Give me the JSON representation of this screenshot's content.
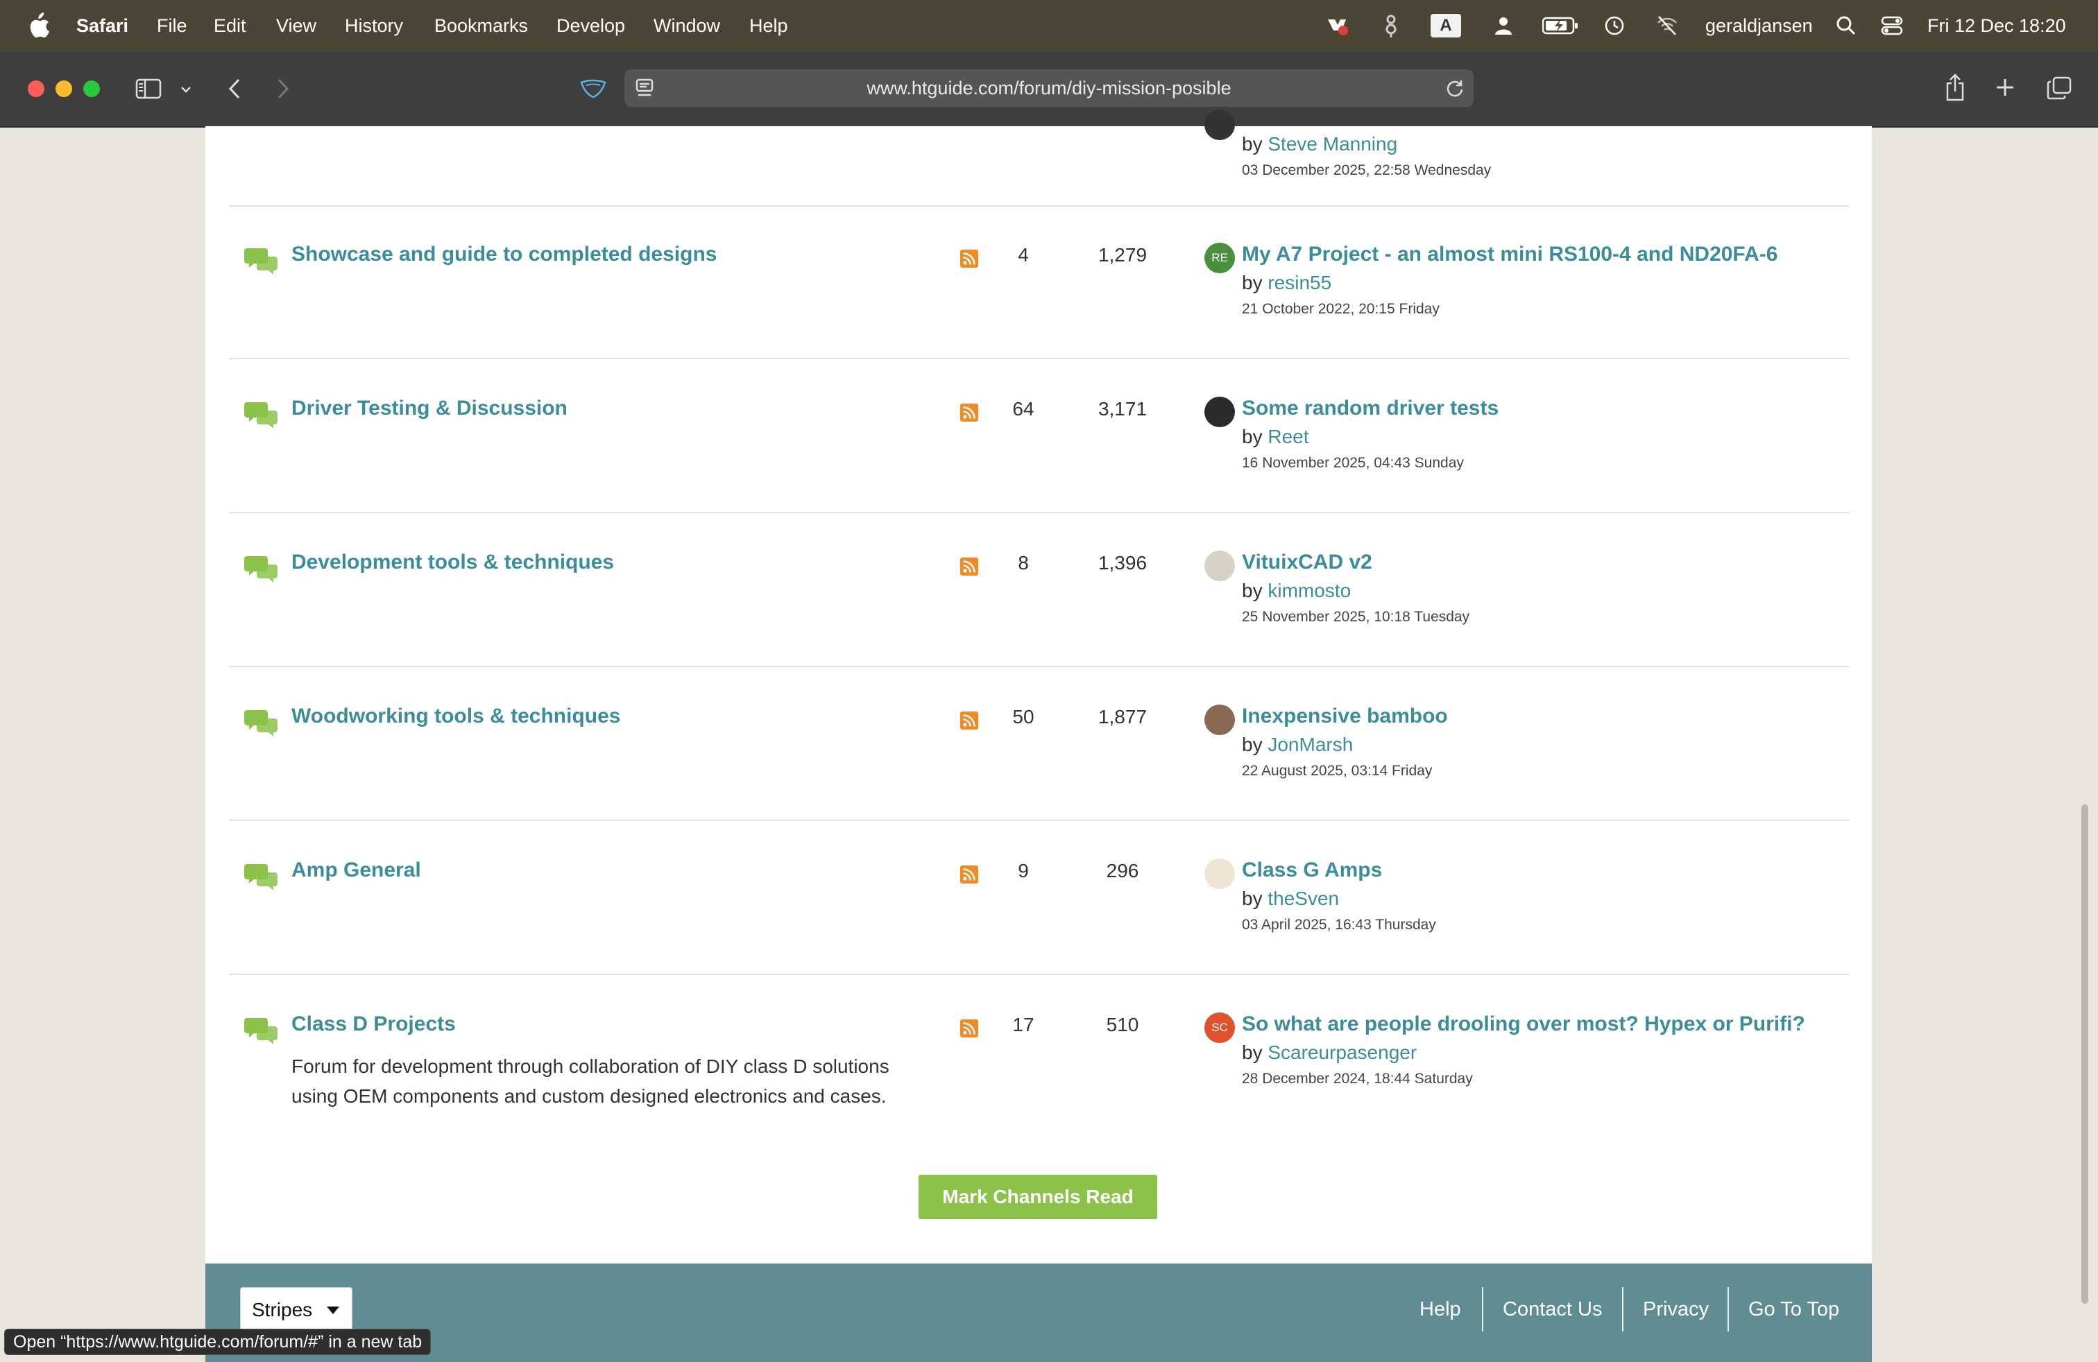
{
  "menubar": {
    "app": "Safari",
    "items": [
      "File",
      "Edit",
      "View",
      "History",
      "Bookmarks",
      "Develop",
      "Window",
      "Help"
    ],
    "user": "geraldjansen",
    "datetime": "Fri 12 Dec  18:20",
    "text_icon": "A"
  },
  "browser": {
    "url": "www.htguide.com/forum/diy-mission-posible"
  },
  "top_row": {
    "author": "Steve Manning",
    "by": "by",
    "date": "03 December 2025, 22:58 Wednesday"
  },
  "forums": [
    {
      "title": "Showcase and guide to completed designs",
      "description": "",
      "topics": "4",
      "posts": "1,279",
      "last_title": "My A7 Project - an almost mini RS100-4 and ND20FA-6",
      "by": "by",
      "last_author": "resin55",
      "last_date": "21 October 2022, 20:15 Friday",
      "avatar_text": "RE",
      "avatar_color": "#4a8f3c"
    },
    {
      "title": "Driver Testing & Discussion",
      "description": "",
      "topics": "64",
      "posts": "3,171",
      "last_title": "Some random driver tests",
      "by": "by",
      "last_author": "Reet",
      "last_date": "16 November 2025, 04:43 Sunday",
      "avatar_text": "",
      "avatar_color": "#2b2b2b"
    },
    {
      "title": "Development tools & techniques",
      "description": "",
      "topics": "8",
      "posts": "1,396",
      "last_title": "VituixCAD v2",
      "by": "by",
      "last_author": "kimmosto",
      "last_date": "25 November 2025, 10:18 Tuesday",
      "avatar_text": "",
      "avatar_color": "#d8d2c6"
    },
    {
      "title": "Woodworking tools & techniques",
      "description": "",
      "topics": "50",
      "posts": "1,877",
      "last_title": "Inexpensive bamboo",
      "by": "by",
      "last_author": "JonMarsh",
      "last_date": "22 August 2025, 03:14 Friday",
      "avatar_text": "",
      "avatar_color": "#8a6a55"
    },
    {
      "title": "Amp General",
      "description": "",
      "topics": "9",
      "posts": "296",
      "last_title": "Class G Amps",
      "by": "by",
      "last_author": "theSven",
      "last_date": "03 April 2025, 16:43 Thursday",
      "avatar_text": "",
      "avatar_color": "#efe6d2"
    },
    {
      "title": "Class D Projects",
      "description": "Forum for development through collaboration of DIY class D solutions using OEM components and custom designed electronics and cases.",
      "topics": "17",
      "posts": "510",
      "last_title": "So what are people drooling over most? Hypex or Purifi?",
      "by": "by",
      "last_author": "Scareurpasenger",
      "last_date": "28 December 2024, 18:44 Saturday",
      "avatar_text": "SC",
      "avatar_color": "#e0522c"
    }
  ],
  "mark_read_label": "Mark Channels Read",
  "footer": {
    "style_select": "Stripes",
    "links": [
      "Help",
      "Contact Us",
      "Privacy",
      "Go To Top"
    ]
  },
  "status_tip": "Open “https://www.htguide.com/forum/#” in a new tab",
  "colors": {
    "link": "#3b8d9b",
    "button": "#8bc34a",
    "footer": "#5f8d93",
    "icon_green": "#8bc34a",
    "rss": "#f08a24"
  },
  "icons": [
    "apple-icon",
    "chat-bubbles-icon",
    "rss-icon",
    "sidebar-icon",
    "back-icon",
    "forward-icon",
    "reload-icon",
    "share-icon",
    "new-tab-icon",
    "tabs-overview-icon",
    "search-icon",
    "control-center-icon"
  ]
}
